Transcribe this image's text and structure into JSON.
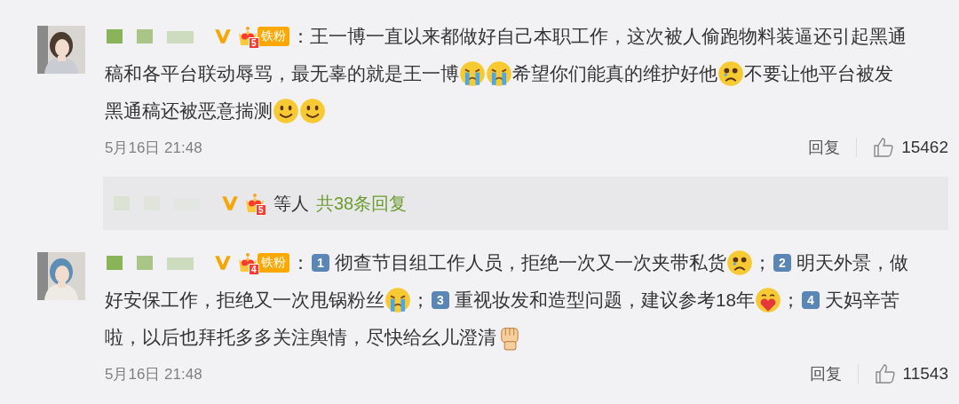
{
  "comments": [
    {
      "avatar": {
        "kind": "picture"
      },
      "verified": true,
      "badge": {
        "level": "5",
        "label": "铁粉"
      },
      "lines": [
        [
          {
            "kind": "text",
            "text": "：王一博一直以来都做好自己本职工作，这次被人偷跑物料装逼还引起黑通"
          }
        ],
        [
          {
            "kind": "text",
            "text": "稿和各平台联动辱骂，最无辜的就是王一博"
          },
          {
            "kind": "cry"
          },
          {
            "kind": "cry"
          },
          {
            "kind": "text",
            "text": "希望你们能真的维护好他"
          },
          {
            "kind": "sad"
          },
          {
            "kind": "text",
            "text": "不要让他平台被发"
          }
        ],
        [
          {
            "kind": "text",
            "text": "黑通稿还被恶意揣测"
          },
          {
            "kind": "smile"
          },
          {
            "kind": "smile"
          }
        ]
      ],
      "time": "5月16日 21:48",
      "reply": "回复",
      "likes": "15462",
      "thread": {
        "verified": true,
        "badge": {
          "level": "5"
        },
        "suffix": "等人",
        "link": "共38条回复"
      }
    },
    {
      "avatar": {
        "kind": "picture"
      },
      "verified": true,
      "badge": {
        "level": "4",
        "label": "铁粉"
      },
      "lines": [
        [
          {
            "kind": "text",
            "text": "："
          },
          {
            "kind": "keycap",
            "text": "1"
          },
          {
            "kind": "text",
            "text": "彻查节目组工作人员，拒绝一次又一次夹带私货"
          },
          {
            "kind": "sad"
          },
          {
            "kind": "text",
            "text": "；"
          },
          {
            "kind": "keycap",
            "text": "2"
          },
          {
            "kind": "text",
            "text": "明天外景，做"
          }
        ],
        [
          {
            "kind": "text",
            "text": "好安保工作，拒绝又一次甩锅粉丝"
          },
          {
            "kind": "cry"
          },
          {
            "kind": "text",
            "text": "；"
          },
          {
            "kind": "keycap",
            "text": "3"
          },
          {
            "kind": "text",
            "text": "重视妆发和造型问题，建议参考18年"
          },
          {
            "kind": "hug"
          },
          {
            "kind": "text",
            "text": "；"
          },
          {
            "kind": "keycap",
            "text": "4"
          },
          {
            "kind": "text",
            "text": "天妈辛苦"
          }
        ],
        [
          {
            "kind": "text",
            "text": "啦，以后也拜托多多关注舆情，尽快给幺儿澄清"
          },
          {
            "kind": "fist"
          }
        ]
      ],
      "time": "5月16日 21:48",
      "reply": "回复",
      "likes": "11543"
    }
  ]
}
